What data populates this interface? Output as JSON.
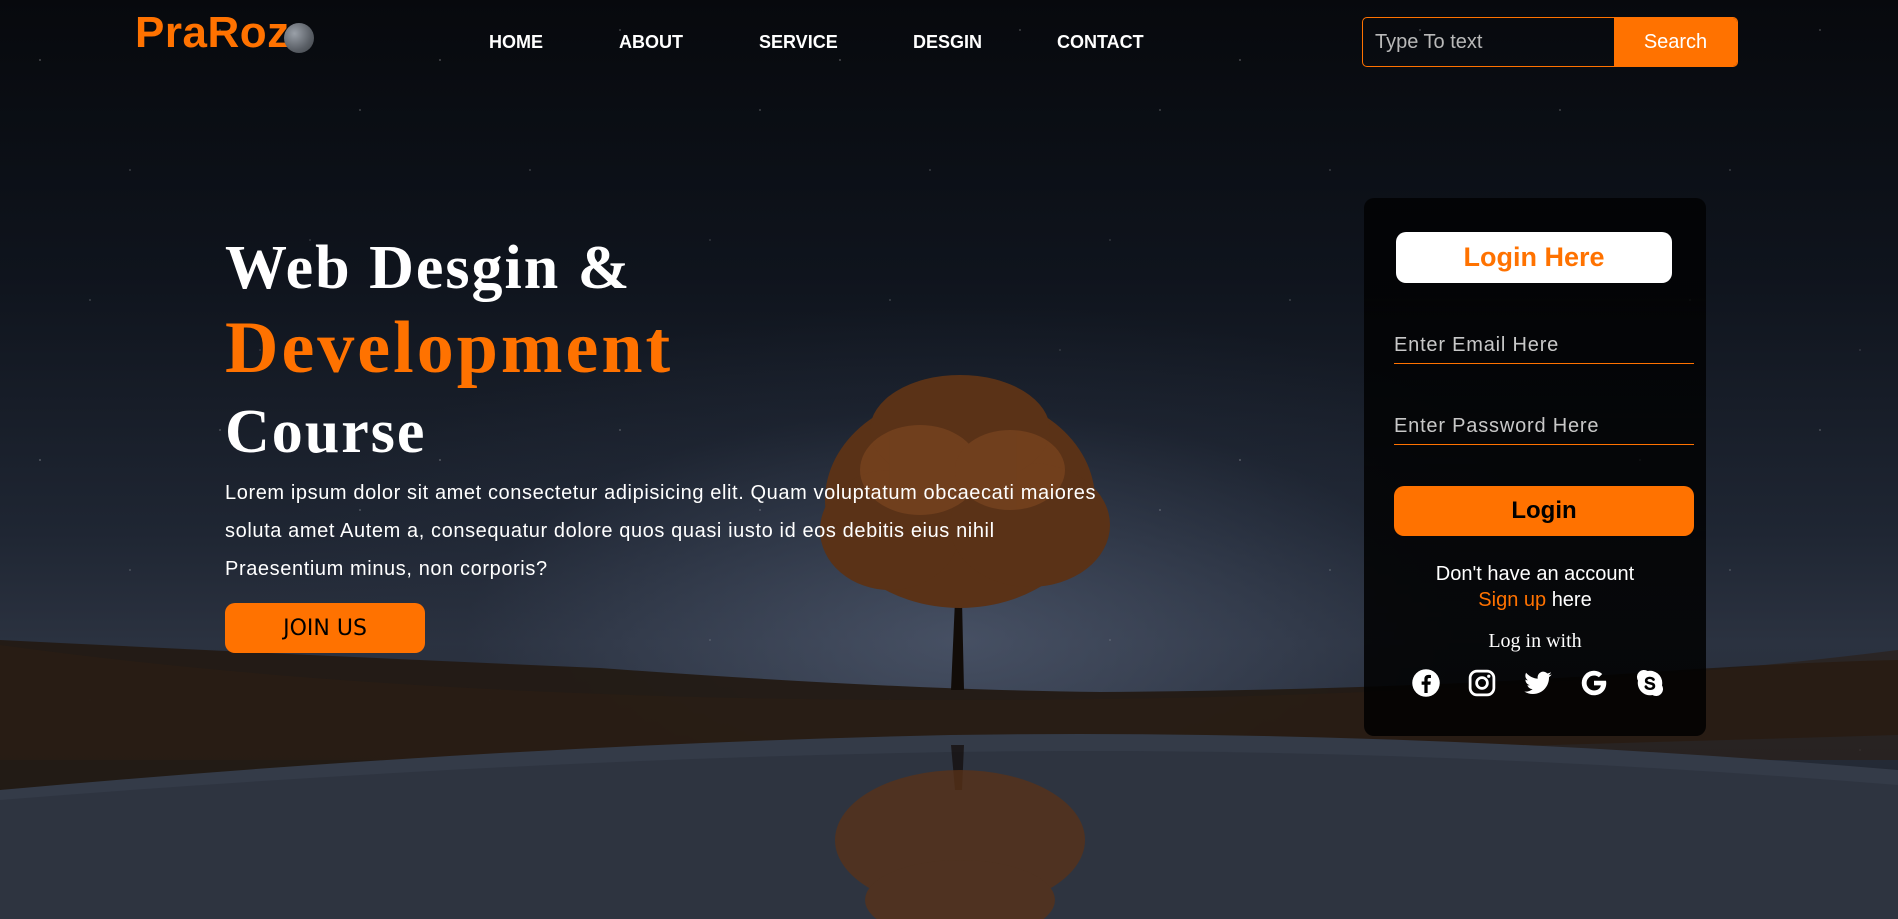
{
  "brand": {
    "name": "PraRoz"
  },
  "nav": {
    "home": "HOME",
    "about": "ABOUT",
    "service": "SERVICE",
    "design": "DESGIN",
    "contact": "CONTACT"
  },
  "search": {
    "placeholder": "Type To text",
    "button": "Search"
  },
  "hero": {
    "line1": "Web Desgin &",
    "line2": "Development",
    "line3": "Course",
    "description": "Lorem ipsum dolor sit amet consectetur adipisicing elit. Quam voluptatum obcaecati maiores soluta amet Autem a, consequatur dolore quos quasi iusto id eos debitis eius nihil Praesentium minus, non corporis?",
    "cta": "JOIN US"
  },
  "login": {
    "title": "Login Here",
    "email_placeholder": "Enter Email Here",
    "password_placeholder": "Enter Password Here",
    "button": "Login",
    "no_account": "Don't have an account",
    "signup_link": "Sign up",
    "signup_suffix": "here",
    "login_with": "Log in with",
    "socials": [
      "facebook",
      "instagram",
      "twitter",
      "google",
      "skype"
    ]
  },
  "colors": {
    "accent": "#ff7200",
    "text": "#ffffff"
  }
}
